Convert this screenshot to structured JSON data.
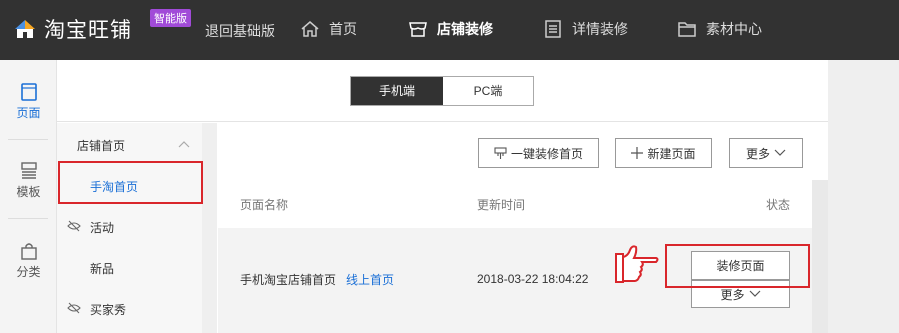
{
  "brand": {
    "name": "淘宝旺铺",
    "edition_badge": "智能版"
  },
  "topnav": {
    "back_label": "退回基础版",
    "items": [
      {
        "label": "首页",
        "icon": "home-icon"
      },
      {
        "label": "店铺装修",
        "icon": "store-icon",
        "active": true
      },
      {
        "label": "详情装修",
        "icon": "document-list-icon"
      },
      {
        "label": "素材中心",
        "icon": "folder-icon"
      }
    ]
  },
  "leftbar": {
    "items": [
      {
        "label": "页面",
        "icon": "page-icon",
        "active": true
      },
      {
        "label": "模板",
        "icon": "template-icon"
      },
      {
        "label": "分类",
        "icon": "bag-icon"
      }
    ]
  },
  "device_toggle": {
    "mobile": "手机端",
    "pc": "PC端",
    "selected": "手机端"
  },
  "page_nav": {
    "group_label": "店铺首页",
    "items": [
      {
        "label": "手淘首页",
        "selected": true
      },
      {
        "label": "活动",
        "icon": "eye-slash-icon"
      },
      {
        "label": "新品"
      },
      {
        "label": "买家秀",
        "icon": "eye-slash-icon"
      }
    ]
  },
  "toolbar": {
    "one_click": "一键装修首页",
    "new_page": "新建页面",
    "more": "更多"
  },
  "table": {
    "headers": {
      "name": "页面名称",
      "updated": "更新时间",
      "status": "状态"
    },
    "rows": [
      {
        "name": "手机淘宝店铺首页",
        "tag": "线上首页",
        "updated": "2018-03-22 18:04:22",
        "action_primary": "装修页面",
        "action_more": "更多"
      }
    ]
  },
  "colors": {
    "topbar": "#323232",
    "accent": "#1a6fd6",
    "badge": "#a14bd8",
    "highlight": "#d9262b"
  }
}
